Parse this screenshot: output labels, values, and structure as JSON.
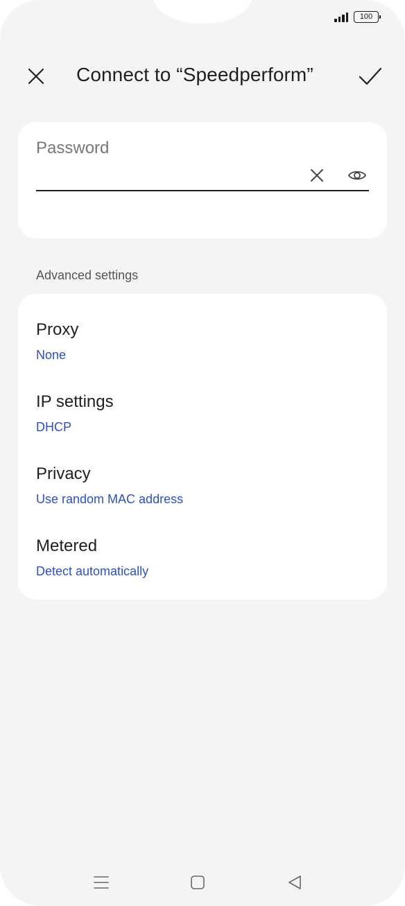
{
  "status_bar": {
    "battery": "100",
    "signal_icon": "signal-icon"
  },
  "app_bar": {
    "title": "Connect to “Speedperform”",
    "close_icon": "close-icon",
    "confirm_icon": "checkmark-icon"
  },
  "password": {
    "label": "Password",
    "value": "",
    "clear_icon": "clear-icon",
    "visibility_icon": "eye-icon"
  },
  "advanced": {
    "section_label": "Advanced settings",
    "items": [
      {
        "title": "Proxy",
        "value": "None"
      },
      {
        "title": "IP settings",
        "value": "DHCP"
      },
      {
        "title": "Privacy",
        "value": "Use random MAC address"
      },
      {
        "title": "Metered",
        "value": "Detect automatically"
      }
    ]
  },
  "nav_bar": {
    "menu_icon": "menu-icon",
    "home_icon": "home-icon",
    "back_icon": "back-icon"
  },
  "colors": {
    "accent": "#2f4fc7",
    "background": "#f4f4f4",
    "card": "#ffffff",
    "text_primary": "#1f1f1f",
    "text_secondary": "#777777"
  }
}
